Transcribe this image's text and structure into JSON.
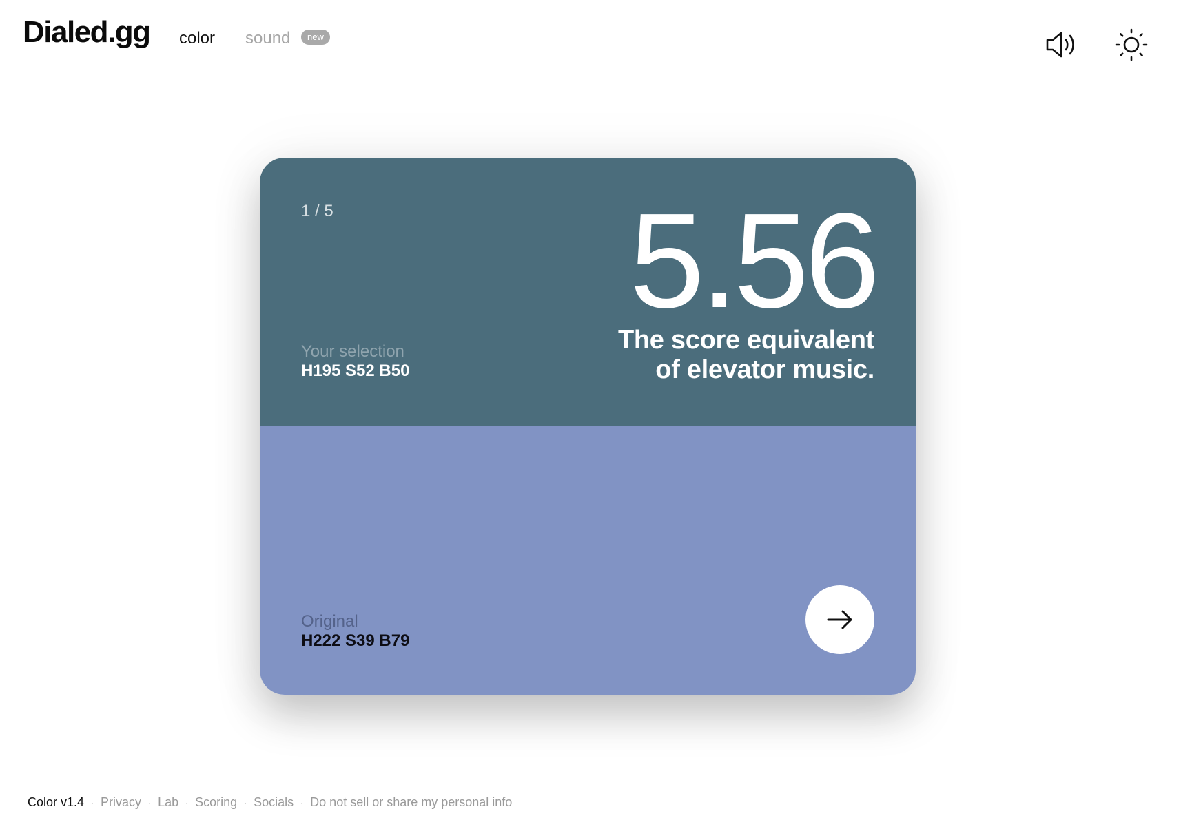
{
  "header": {
    "logo": "Dialed.gg",
    "nav": {
      "color": "color",
      "sound": "sound",
      "sound_badge": "new"
    },
    "icons": [
      "speaker-icon",
      "sun-icon"
    ]
  },
  "card": {
    "counter": "1 / 5",
    "score": "5.56",
    "tagline": "The score equivalent of elevator music.",
    "selection": {
      "label": "Your selection",
      "value": "H195 S52 B50",
      "color": "#4B6D7C"
    },
    "original": {
      "label": "Original",
      "value": "H222 S39 B79",
      "color": "#8193C4"
    },
    "next_icon": "arrow-right-icon"
  },
  "footer": {
    "version": "Color v1.4",
    "links": [
      "Privacy",
      "Lab",
      "Scoring",
      "Socials",
      "Do not sell or share my personal info"
    ]
  }
}
